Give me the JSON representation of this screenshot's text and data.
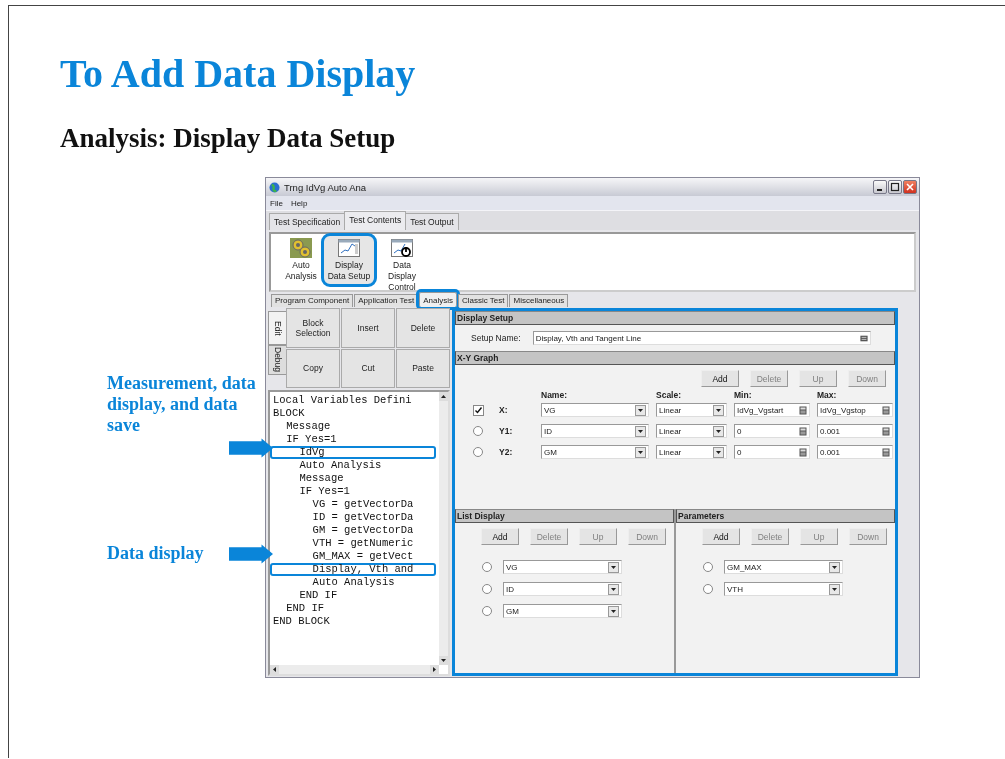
{
  "slide": {
    "title": "To Add Data Display",
    "subtitle": "Analysis: Display Data Setup"
  },
  "callouts": [
    {
      "text": "Measurement, data display, and data save"
    },
    {
      "text": "Data display"
    }
  ],
  "window": {
    "title": "Trng IdVg Auto Ana"
  },
  "menu": [
    "File",
    "Help"
  ],
  "tabs": [
    {
      "label": "Test Specification",
      "selected": false
    },
    {
      "label": "Test Contents",
      "selected": true
    },
    {
      "label": "Test Output",
      "selected": false
    }
  ],
  "toolbar": [
    {
      "label": "Auto Analysis",
      "kind": "gears",
      "selected": false,
      "highlighted": false
    },
    {
      "label": "Display Data Setup",
      "kind": "chart",
      "selected": true,
      "highlighted": true
    },
    {
      "label": "Data Display Control",
      "kind": "chart-power",
      "selected": false,
      "highlighted": false
    }
  ],
  "sub_tabs": [
    {
      "label": "Program Component",
      "selected": false,
      "highlighted": false
    },
    {
      "label": "Application Test",
      "selected": false,
      "highlighted": false
    },
    {
      "label": "Analysis",
      "selected": true,
      "highlighted": true
    },
    {
      "label": "Classic Test",
      "selected": false,
      "highlighted": false
    },
    {
      "label": "Miscellaneous",
      "selected": false,
      "highlighted": false
    }
  ],
  "side_tabs": [
    {
      "label": "Edit",
      "selected": true
    },
    {
      "label": "Debug",
      "selected": false
    }
  ],
  "edit_buttons": [
    "Block Selection",
    "Insert",
    "Delete",
    "Copy",
    "Cut",
    "Paste"
  ],
  "program_tree": [
    {
      "text": "Local Variables Defini",
      "highlighted": false
    },
    {
      "text": "BLOCK",
      "highlighted": false,
      "children": [
        {
          "text": "Message",
          "highlighted": false
        },
        {
          "text": "IF Yes=1",
          "highlighted": false,
          "children": [
            {
              "text": "IdVg",
              "highlighted": true
            },
            {
              "text": "Auto Analysis",
              "highlighted": false
            },
            {
              "text": "Message",
              "highlighted": false
            },
            {
              "text": "IF Yes=1",
              "highlighted": false,
              "children": [
                {
                  "text": "VG = getVectorDa",
                  "highlighted": false
                },
                {
                  "text": "ID = getVectorDa",
                  "highlighted": false
                },
                {
                  "text": "GM = getVectorDa",
                  "highlighted": false
                },
                {
                  "text": "VTH = getNumeric",
                  "highlighted": false
                },
                {
                  "text": "GM_MAX = getVect",
                  "highlighted": false
                },
                {
                  "text": "Display, Vth and",
                  "highlighted": true
                },
                {
                  "text": "Auto Analysis",
                  "highlighted": false
                }
              ]
            },
            {
              "text": "END IF",
              "highlighted": false
            }
          ]
        },
        {
          "text": "END IF",
          "highlighted": false
        }
      ]
    },
    {
      "text": "END BLOCK",
      "highlighted": false
    }
  ],
  "display_setup": {
    "title": "Display Setup",
    "highlighted": true,
    "setup_name_label": "Setup Name:",
    "setup_name": "Display, Vth and Tangent Line"
  },
  "xy_graph": {
    "title": "X-Y Graph",
    "buttons": [
      {
        "label": "Add",
        "disabled": false
      },
      {
        "label": "Delete",
        "disabled": true
      },
      {
        "label": "Up",
        "disabled": true
      },
      {
        "label": "Down",
        "disabled": true
      }
    ],
    "columns": [
      "Name:",
      "Scale:",
      "Min:",
      "Max:"
    ],
    "rows": [
      {
        "kind": "checkbox",
        "checked": true,
        "label": "X:",
        "name": "VG",
        "scale": "Linear",
        "min": "IdVg_Vgstart",
        "max": "IdVg_Vgstop"
      },
      {
        "kind": "radio",
        "selected": false,
        "label": "Y1:",
        "name": "ID",
        "scale": "Linear",
        "min": "0",
        "max": "0.001"
      },
      {
        "kind": "radio",
        "selected": false,
        "label": "Y2:",
        "name": "GM",
        "scale": "Linear",
        "min": "0",
        "max": "0.001"
      }
    ]
  },
  "list_display": {
    "title": "List Display",
    "buttons": [
      {
        "label": "Add",
        "disabled": false
      },
      {
        "label": "Delete",
        "disabled": true
      },
      {
        "label": "Up",
        "disabled": true
      },
      {
        "label": "Down",
        "disabled": true
      }
    ],
    "rows": [
      {
        "selected": false,
        "value": "VG"
      },
      {
        "selected": false,
        "value": "ID"
      },
      {
        "selected": false,
        "value": "GM"
      }
    ]
  },
  "parameters": {
    "title": "Parameters",
    "buttons": [
      {
        "label": "Add",
        "disabled": false
      },
      {
        "label": "Delete",
        "disabled": true
      },
      {
        "label": "Up",
        "disabled": true
      },
      {
        "label": "Down",
        "disabled": true
      }
    ],
    "rows": [
      {
        "selected": false,
        "value": "GM_MAX"
      },
      {
        "selected": false,
        "value": "VTH"
      }
    ]
  }
}
